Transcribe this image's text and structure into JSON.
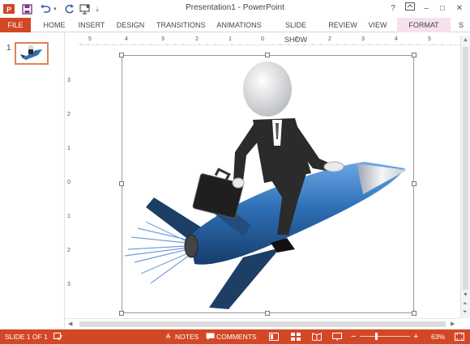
{
  "window": {
    "title": "Presentation1 - PowerPoint",
    "help": "?",
    "minimize": "–",
    "restore": "□",
    "close": "✕"
  },
  "quick_access": {
    "app_icon": "powerpoint-icon",
    "save_icon": "save-icon",
    "undo_icon": "undo-icon",
    "redo_icon": "redo-icon",
    "slideshow_icon": "start-slideshow-icon",
    "customize_icon": "customize-qat-icon"
  },
  "ribbon": {
    "tabs": [
      "FILE",
      "HOME",
      "INSERT",
      "DESIGN",
      "TRANSITIONS",
      "ANIMATIONS",
      "SLIDE SHOW",
      "REVIEW",
      "VIEW",
      "FORMAT",
      "S"
    ],
    "active_contextual": "FORMAT"
  },
  "thumbnails": {
    "slide_number": "1"
  },
  "rulers": {
    "horizontal": [
      "5",
      "4",
      "3",
      "2",
      "1",
      "0",
      "1",
      "2",
      "3",
      "4",
      "5"
    ],
    "vertical": [
      "3",
      "2",
      "1",
      "0",
      "1",
      "2",
      "3"
    ]
  },
  "status": {
    "slide_info": "SLIDE 1 OF 1",
    "notes": "NOTES",
    "comments": "COMMENTS",
    "zoom": "63%",
    "zoom_minus": "−",
    "zoom_plus": "+"
  },
  "colors": {
    "accent": "#d24726",
    "format_tab": "#f6e1ef",
    "rocket_body": "#2e6fb5",
    "rocket_dark": "#1d3f66",
    "suit": "#2b2b2b"
  }
}
